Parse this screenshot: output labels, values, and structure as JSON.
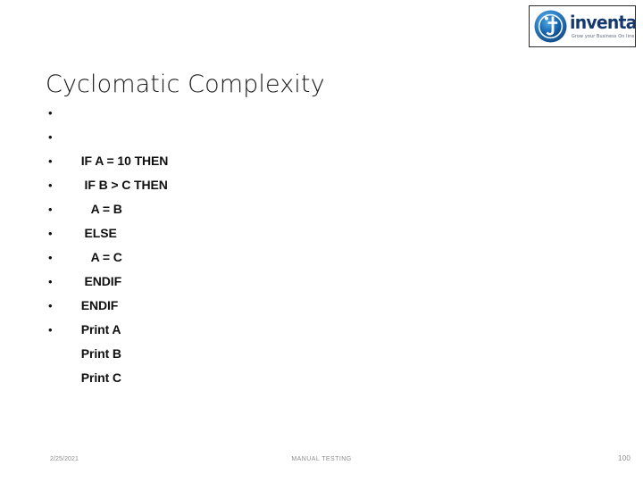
{
  "slide": {
    "title": "Cyclomatic Complexity",
    "background_color": "#ffffff",
    "title_color": "#1a1a1a"
  },
  "logo": {
    "wordmark": "inventateq",
    "tagline": "Grow your Business On line",
    "emblem_letter": "t",
    "brand_color": "#15386e",
    "emblem_color": "#1b6fc4",
    "border_color": "#2b2b2b"
  },
  "content": {
    "bullet_glyph": "•",
    "items": [
      {
        "text": "IF A = 10 THEN"
      },
      {
        "text": " IF B > C THEN"
      },
      {
        "text": "   A = B"
      },
      {
        "text": " ELSE"
      },
      {
        "text": "   A = C"
      },
      {
        "text": " ENDIF"
      },
      {
        "text": "ENDIF"
      },
      {
        "text": "Print A"
      },
      {
        "text": "Print B"
      },
      {
        "text": "Print C"
      }
    ]
  },
  "footer": {
    "date": "2/25/2021",
    "center_text": "MANUAL TESTING",
    "page_number": "100",
    "text_color": "#8c8c8c"
  }
}
